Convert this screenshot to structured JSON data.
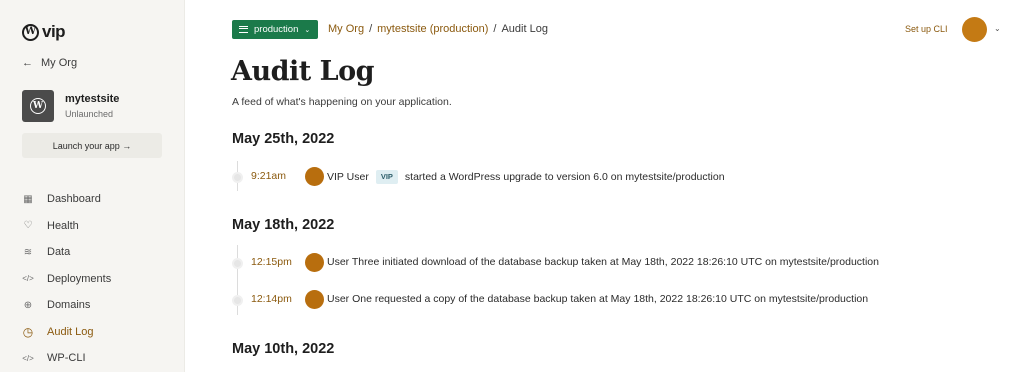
{
  "brand": {
    "logo_letter": "W",
    "logo_text": "vip"
  },
  "sidebar": {
    "back_label": "My Org",
    "site": {
      "name": "mytestsite",
      "status": "Unlaunched",
      "icon_letter": "W"
    },
    "launch_button": "Launch your app →",
    "items": [
      {
        "label": "Dashboard",
        "icon": "grid-icon",
        "glyph": "▦"
      },
      {
        "label": "Health",
        "icon": "health-icon",
        "glyph": "♡"
      },
      {
        "label": "Data",
        "icon": "database-icon",
        "glyph": "≋"
      },
      {
        "label": "Deployments",
        "icon": "code-icon",
        "glyph": "</>"
      },
      {
        "label": "Domains",
        "icon": "globe-icon",
        "glyph": "⊕"
      },
      {
        "label": "Audit Log",
        "icon": "clock-icon",
        "glyph": "◷",
        "active": true
      },
      {
        "label": "WP-CLI",
        "icon": "code-icon",
        "glyph": "</>"
      }
    ]
  },
  "header": {
    "environment": "production",
    "breadcrumb": [
      "My Org",
      "mytestsite (production)",
      "Audit Log"
    ],
    "setup_cli": "Set up CLI"
  },
  "main": {
    "title": "Audit Log",
    "subtitle": "A feed of what's happening on your application.",
    "days": [
      {
        "date": "May 25th, 2022",
        "entries": [
          {
            "time": "9:21am",
            "user": "VIP User",
            "badge": "VIP",
            "text": "started a WordPress upgrade to version 6.0 on mytestsite/production"
          }
        ]
      },
      {
        "date": "May 18th, 2022",
        "entries": [
          {
            "time": "12:15pm",
            "text": "User Three initiated download of the database backup taken at May 18th, 2022 18:26:10 UTC on mytestsite/production"
          },
          {
            "time": "12:14pm",
            "text": "User One requested a copy of the database backup taken at May 18th, 2022 18:26:10 UTC on mytestsite/production"
          }
        ]
      },
      {
        "date": "May 10th, 2022",
        "entries": []
      }
    ]
  },
  "colors": {
    "accent": "#8b5a0f",
    "env_green": "#1b7a4a",
    "avatar": "#c47a14",
    "sidebar_bg": "#f6f5f2"
  }
}
